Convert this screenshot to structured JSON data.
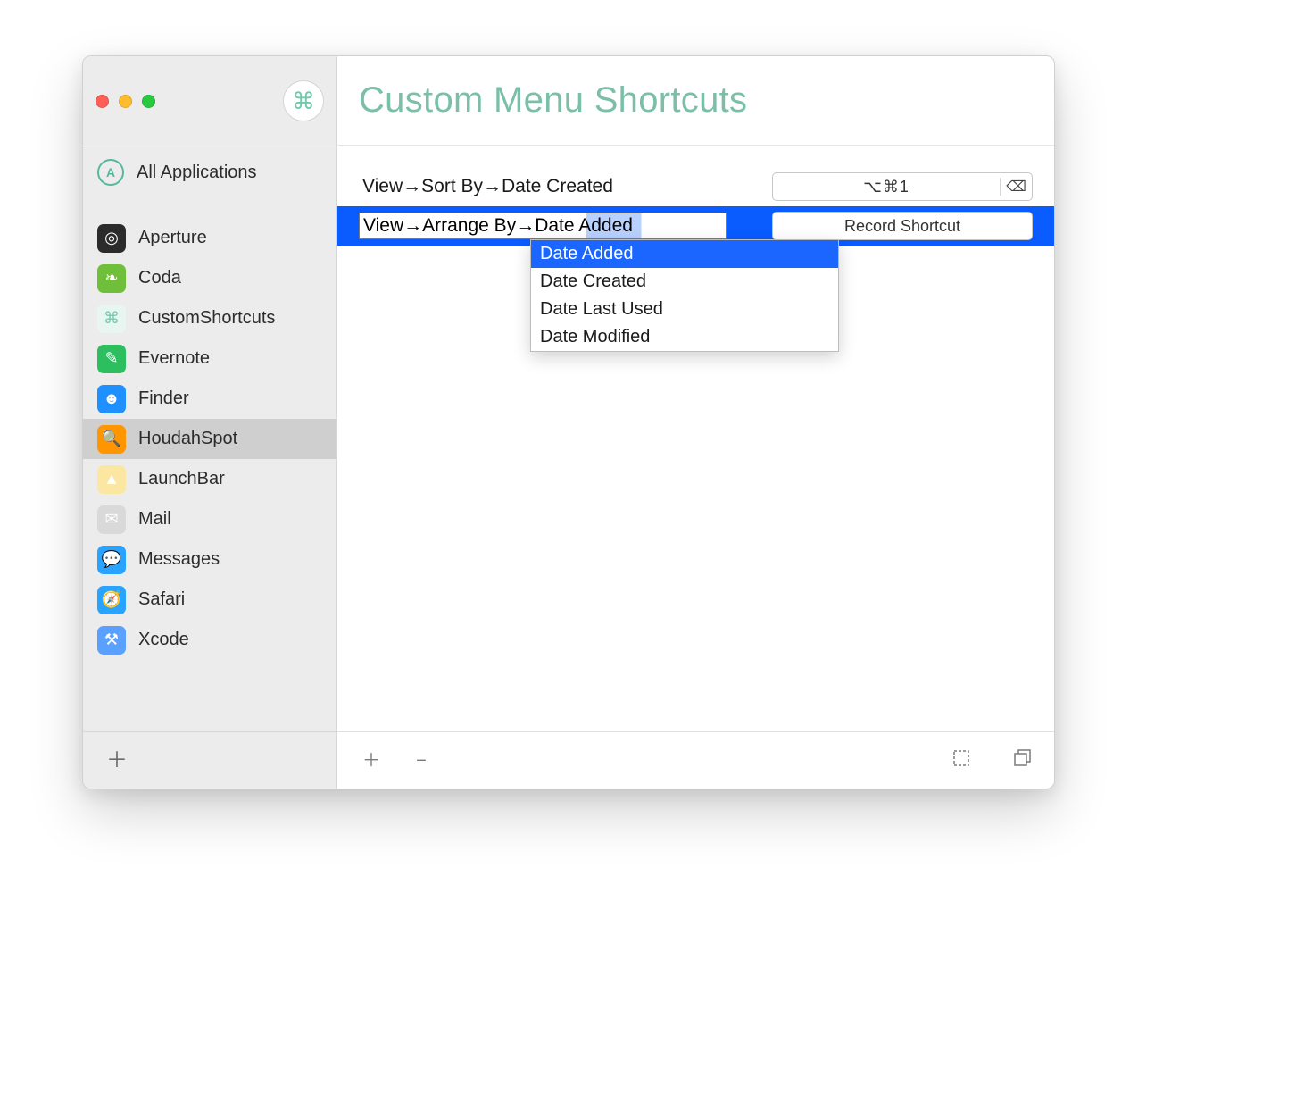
{
  "window": {
    "title_icon_glyph": "⌘"
  },
  "sidebar": {
    "all_apps_label": "All Applications",
    "apps": [
      {
        "name": "Aperture",
        "icon_name": "aperture-icon",
        "bg": "#2b2b2b",
        "glyph": "◎"
      },
      {
        "name": "Coda",
        "icon_name": "coda-icon",
        "bg": "#6fbf3a",
        "glyph": "❧"
      },
      {
        "name": "CustomShortcuts",
        "icon_name": "customshortcuts-icon",
        "bg": "#e8f6f1",
        "glyph": "⌘"
      },
      {
        "name": "Evernote",
        "icon_name": "evernote-icon",
        "bg": "#2dbe60",
        "glyph": "✎"
      },
      {
        "name": "Finder",
        "icon_name": "finder-icon",
        "bg": "#1e90ff",
        "glyph": "☻"
      },
      {
        "name": "HoudahSpot",
        "icon_name": "houdahspot-icon",
        "bg": "#ff9500",
        "glyph": "🔍"
      },
      {
        "name": "LaunchBar",
        "icon_name": "launchbar-icon",
        "bg": "#fbe7a1",
        "glyph": "▲"
      },
      {
        "name": "Mail",
        "icon_name": "mail-icon",
        "bg": "#d9d9d9",
        "glyph": "✉"
      },
      {
        "name": "Messages",
        "icon_name": "messages-icon",
        "bg": "#2aa3ff",
        "glyph": "💬"
      },
      {
        "name": "Safari",
        "icon_name": "safari-icon",
        "bg": "#2aa3ff",
        "glyph": "🧭"
      },
      {
        "name": "Xcode",
        "icon_name": "xcode-icon",
        "bg": "#5aa0ff",
        "glyph": "⚒"
      }
    ],
    "selected_index": 5
  },
  "main": {
    "title": "Custom Menu Shortcuts",
    "rows": [
      {
        "menu_path": "View→Sort By→Date Created",
        "shortcut_display": "⌥⌘1"
      }
    ],
    "editing_row": {
      "menu_path_value": "View→Arrange By→Date Added",
      "record_button_label": "Record Shortcut"
    },
    "autocomplete": {
      "options": [
        "Date Added",
        "Date Created",
        "Date Last Used",
        "Date Modified"
      ],
      "selected_index": 0
    }
  },
  "footer": {
    "add_glyph": "＋",
    "remove_glyph": "−",
    "record_all_glyph": "⧉",
    "duplicate_glyph": "⧉"
  }
}
